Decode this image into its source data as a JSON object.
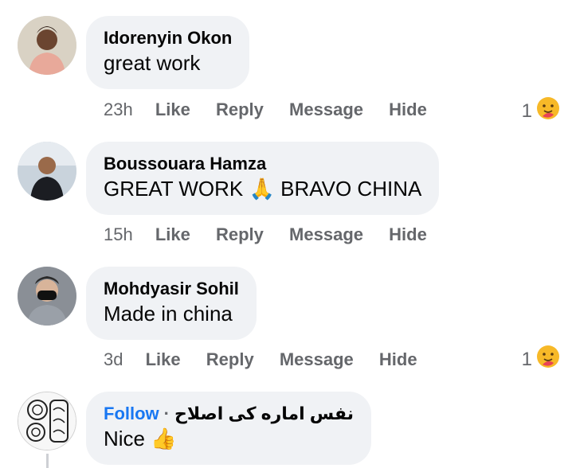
{
  "comments": [
    {
      "author": "Idorenyin Okon",
      "text": "great work",
      "time": "23h",
      "actions": [
        "Like",
        "Reply",
        "Message",
        "Hide"
      ],
      "reaction_count": "1",
      "reaction_icon": "hug-emoji-icon"
    },
    {
      "author": "Boussouara Hamza",
      "text_before": "GREAT WORK ",
      "text_emoji": "🙏",
      "text_after": " BRAVO CHINA",
      "time": "15h",
      "actions": [
        "Like",
        "Reply",
        "Message",
        "Hide"
      ]
    },
    {
      "author": "Mohdyasir Sohil",
      "text": "Made in china",
      "time": "3d",
      "actions": [
        "Like",
        "Reply",
        "Message",
        "Hide"
      ],
      "reaction_count": "1",
      "reaction_icon": "hug-emoji-icon"
    },
    {
      "follow_label": "Follow",
      "separator": "·",
      "author": "نفس اماره کی اصلاح",
      "text": "Nice",
      "text_emoji": "👍"
    }
  ],
  "colors": {
    "bubble": "#f0f2f5",
    "muted": "#65676b",
    "link": "#1877f2"
  }
}
